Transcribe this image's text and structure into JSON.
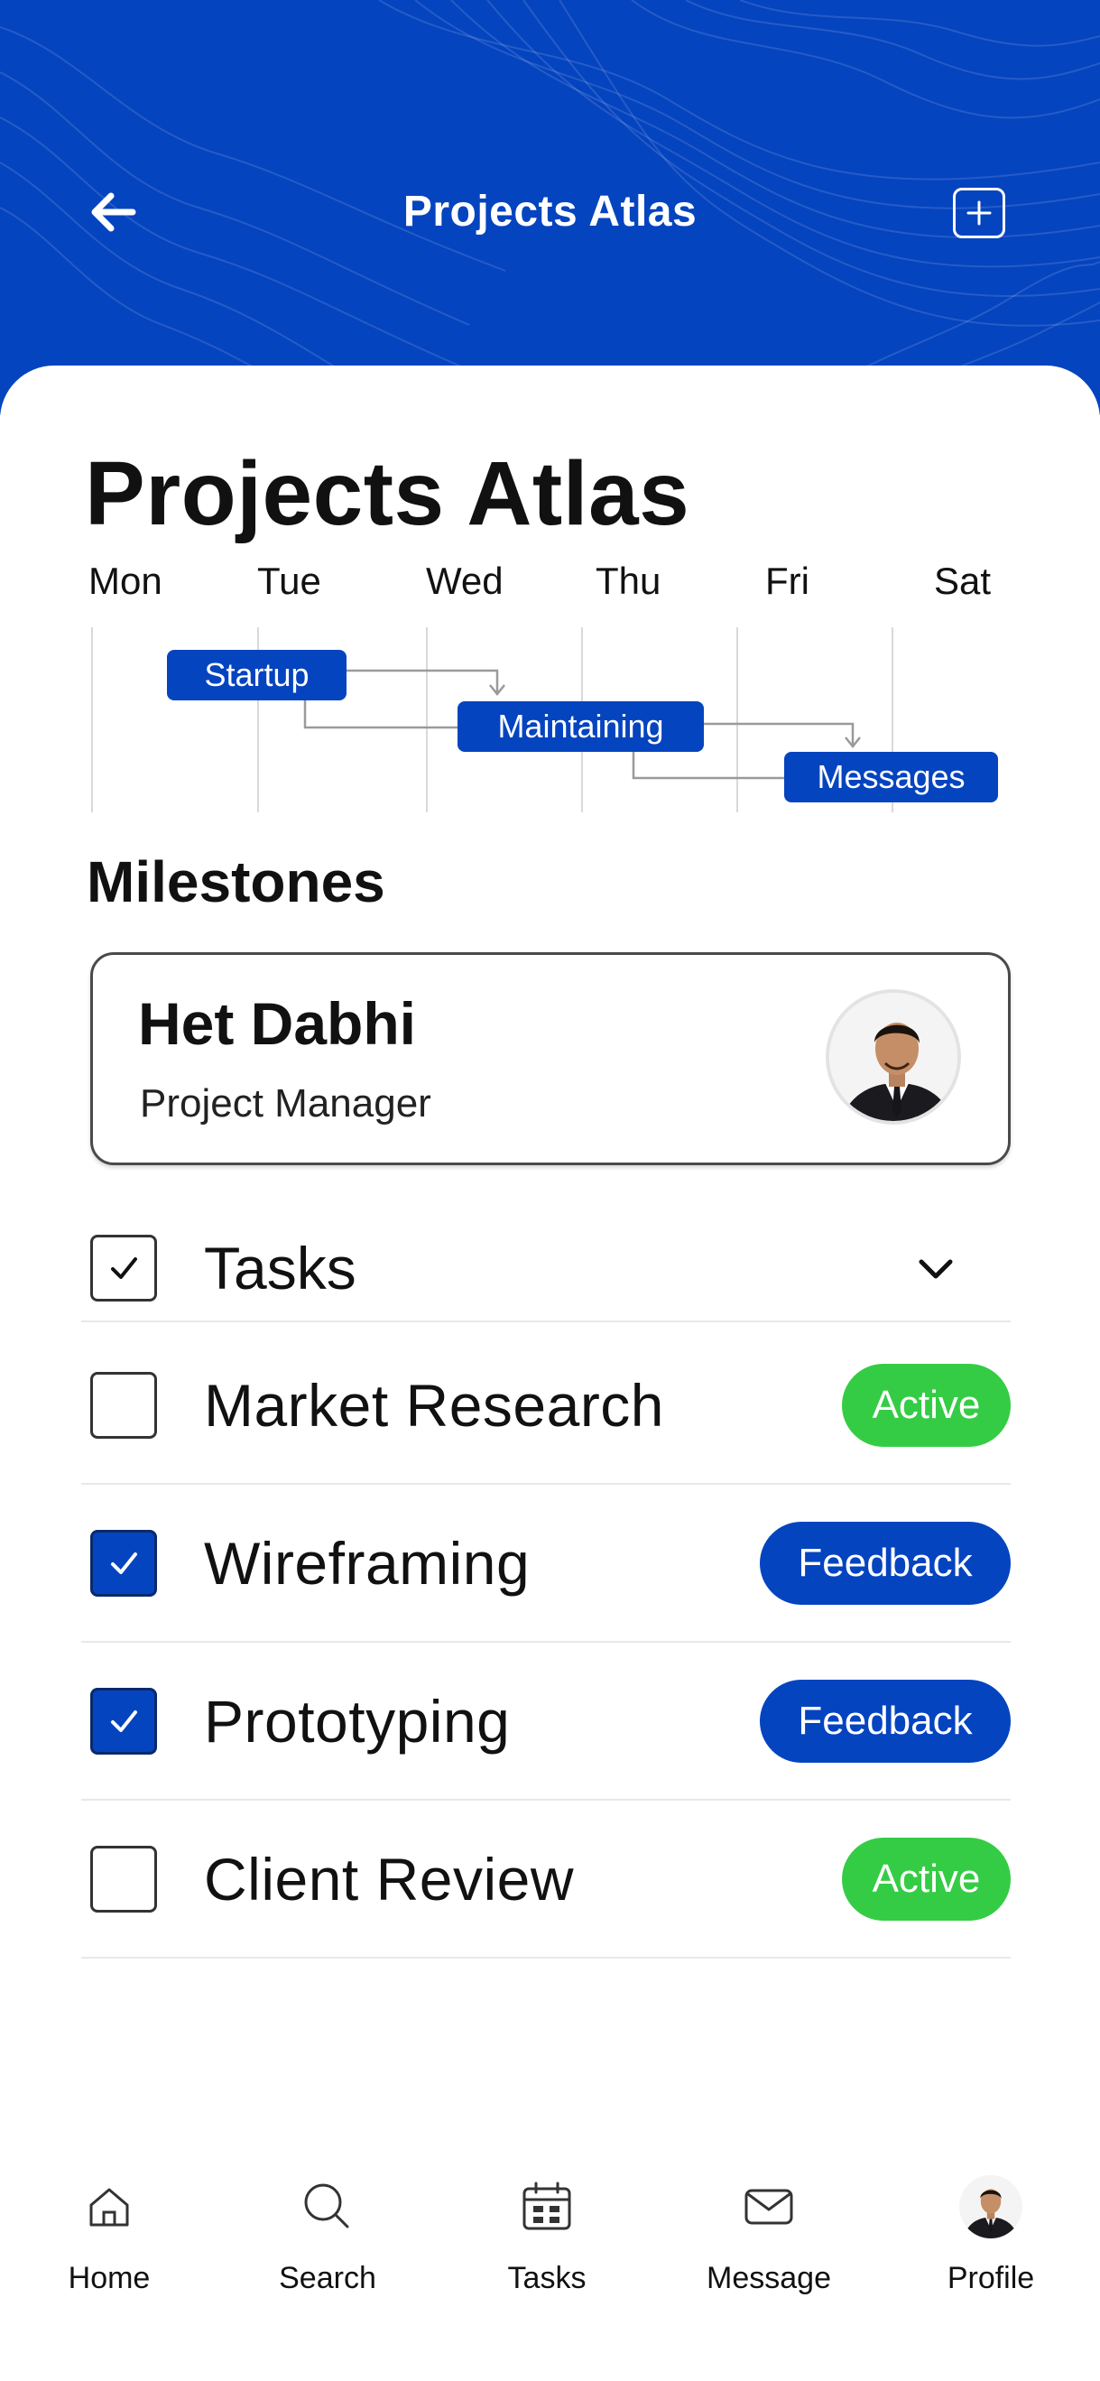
{
  "header": {
    "title": "Projects Atlas",
    "back_icon": "arrow-left-icon",
    "add_icon": "plus-square-icon",
    "bg_color": "#0544bf"
  },
  "page_title": "Projects Atlas",
  "timeline": {
    "days": [
      "Mon",
      "Tue",
      "Wed",
      "Thu",
      "Fri",
      "Sat"
    ],
    "phases": [
      "Startup",
      "Maintaining",
      "Messages"
    ]
  },
  "milestones": {
    "title": "Milestones",
    "manager": {
      "name": "Het Dabhi",
      "role": "Project Manager"
    }
  },
  "tasks": {
    "label": "Tasks",
    "items": [
      {
        "name": "Market Research",
        "checked": false,
        "status": "Active"
      },
      {
        "name": "Wireframing",
        "checked": true,
        "status": "Feedback"
      },
      {
        "name": "Prototyping",
        "checked": true,
        "status": "Feedback"
      },
      {
        "name": "Client Review",
        "checked": false,
        "status": "Active"
      }
    ]
  },
  "colors": {
    "primary": "#0544bf",
    "active": "#35cc45"
  },
  "nav": {
    "items": [
      {
        "label": "Home",
        "icon": "home-icon"
      },
      {
        "label": "Search",
        "icon": "search-icon"
      },
      {
        "label": "Tasks",
        "icon": "calendar-icon"
      },
      {
        "label": "Message",
        "icon": "mail-icon"
      },
      {
        "label": "Profile",
        "icon": "avatar"
      }
    ]
  }
}
